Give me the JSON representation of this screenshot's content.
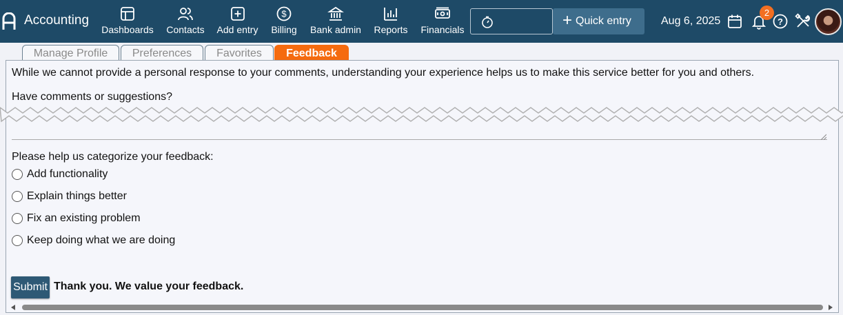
{
  "app": {
    "title": "Accounting"
  },
  "nav": {
    "dashboards": "Dashboards",
    "contacts": "Contacts",
    "add_entry": "Add entry",
    "billing": "Billing",
    "bank_admin": "Bank admin",
    "reports": "Reports",
    "financials": "Financials"
  },
  "toolbar": {
    "quick_entry": "Quick entry",
    "date": "Aug 6, 2025",
    "notification_count": "2"
  },
  "tabs": {
    "manage_profile": "Manage Profile",
    "preferences": "Preferences",
    "favorites": "Favorites",
    "feedback": "Feedback",
    "active": "Feedback"
  },
  "feedback": {
    "intro": "While we cannot provide a personal response to your comments, understanding your experience helps us to make this service better for you and others.",
    "question": "Have comments or suggestions?",
    "comment_value": "",
    "categorize_label": "Please help us categorize your feedback:",
    "options": [
      "Add functionality",
      "Explain things better",
      "Fix an existing problem",
      "Keep doing what we are doing"
    ],
    "submit_label": "Submit",
    "thanks": "Thank you. We value your feedback."
  },
  "colors": {
    "header_bg": "#1e4a67",
    "quick_entry_bg": "#3e6d8c",
    "active_tab": "#f56b0f",
    "badge": "#f36f21",
    "submit_bg": "#2e5975"
  }
}
